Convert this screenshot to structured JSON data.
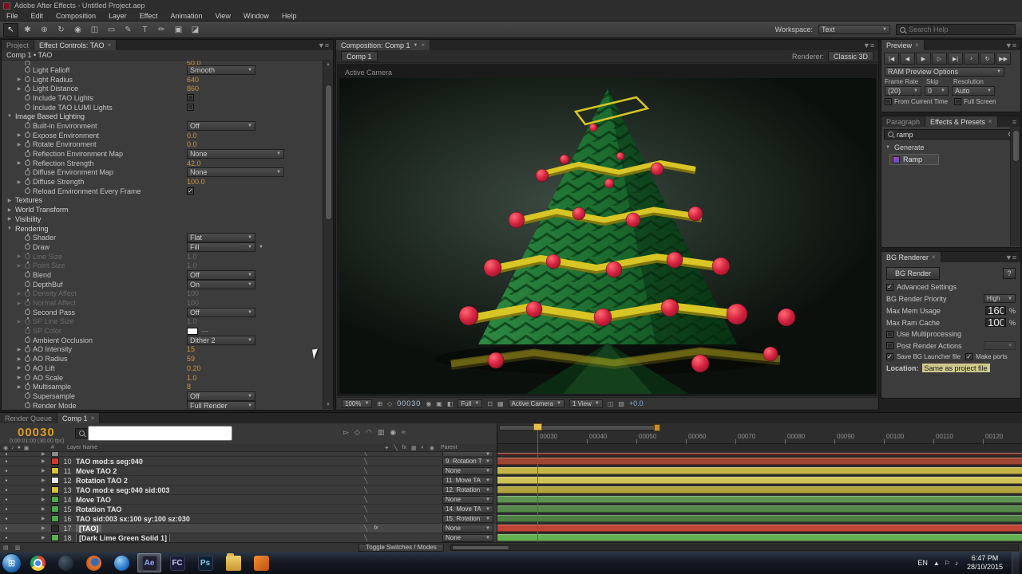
{
  "theme": {
    "value_orange": "#c9953a",
    "time_orange": "#d89a2a",
    "ribbon_yellow": "#d8c526",
    "ribbon_dark": "#8a7a10",
    "bauble_red": "#d42240",
    "tree_green": "#1c6b30"
  },
  "titlebar": {
    "title": "Adobe After Effects - Untitled Project.aep"
  },
  "menubar": {
    "items": [
      "File",
      "Edit",
      "Composition",
      "Layer",
      "Effect",
      "Animation",
      "View",
      "Window",
      "Help"
    ]
  },
  "toolbar": {
    "tools": [
      {
        "name": "selection-tool",
        "glyph": "↖",
        "active": true
      },
      {
        "name": "hand-tool",
        "glyph": "✱"
      },
      {
        "name": "zoom-tool",
        "glyph": "⊕"
      },
      {
        "name": "rotation-tool",
        "glyph": "↻"
      },
      {
        "name": "unified-camera-tool",
        "glyph": "◉"
      },
      {
        "name": "pan-behind-tool",
        "glyph": "◫"
      },
      {
        "name": "shape-tool",
        "glyph": "▭"
      },
      {
        "name": "pen-tool",
        "glyph": "✎"
      },
      {
        "name": "type-tool",
        "glyph": "T"
      },
      {
        "name": "brush-tool",
        "glyph": "✏"
      },
      {
        "name": "clone-stamp-tool",
        "glyph": "▣"
      },
      {
        "name": "eraser-tool",
        "glyph": "◪"
      }
    ],
    "workspace_label": "Workspace:",
    "workspace_value": "Text",
    "search_placeholder": "Search Help"
  },
  "effect_controls": {
    "project_tab": "Project",
    "tab": "Effect Controls: TAO",
    "breadcrumb": "Comp 1 • TAO",
    "rows": [
      {
        "label": "",
        "type": "value",
        "value": "50.0",
        "indent": 1,
        "partial": true
      },
      {
        "label": "Light Falloff",
        "type": "dropdown",
        "value": "Smooth",
        "indent": 1
      },
      {
        "label": "Light Radius",
        "type": "value",
        "value": "640",
        "indent": 1,
        "arrow": true
      },
      {
        "label": "Light Distance",
        "type": "value",
        "value": "860",
        "indent": 1,
        "arrow": true
      },
      {
        "label": "Include TAO Lights",
        "type": "check",
        "checked": false,
        "indent": 1
      },
      {
        "label": "Include TAO LUMI Lights",
        "type": "check",
        "checked": false,
        "indent": 1
      },
      {
        "label": "Image Based Lighting",
        "type": "group",
        "expanded": true,
        "indent": 0
      },
      {
        "label": "Built-in Environment",
        "type": "dropdown",
        "value": "Off",
        "indent": 1
      },
      {
        "label": "Expose Environment",
        "type": "value",
        "value": "0.0",
        "indent": 1,
        "arrow": true
      },
      {
        "label": "Rotate Environment",
        "type": "value",
        "value": "0.0",
        "indent": 1,
        "arrow": true
      },
      {
        "label": "Reflection Environment Map",
        "type": "dropdown",
        "value": "None",
        "indent": 1,
        "wide": true
      },
      {
        "label": "Reflection Strength",
        "type": "value",
        "value": "42.0",
        "indent": 1,
        "arrow": true
      },
      {
        "label": "Diffuse Environment Map",
        "type": "dropdown",
        "value": "None",
        "indent": 1,
        "wide": true
      },
      {
        "label": "Diffuse Strength",
        "type": "value",
        "value": "100.0",
        "indent": 1,
        "arrow": true
      },
      {
        "label": "Reload Environment Every Frame",
        "type": "check",
        "checked": true,
        "indent": 1
      },
      {
        "label": "Textures",
        "type": "group",
        "expanded": false,
        "indent": 0
      },
      {
        "label": "World Transform",
        "type": "group",
        "expanded": false,
        "indent": 0
      },
      {
        "label": "Visibility",
        "type": "group",
        "expanded": false,
        "indent": 0
      },
      {
        "label": "Rendering",
        "type": "group",
        "expanded": true,
        "indent": 0
      },
      {
        "label": "Shader",
        "type": "dropdown",
        "value": "Flat",
        "indent": 1
      },
      {
        "label": "Draw",
        "type": "dropdown",
        "value": "Fill",
        "indent": 1,
        "extra_arrow": true
      },
      {
        "label": "Line Size",
        "type": "value",
        "value": "1.0",
        "indent": 1,
        "arrow": true,
        "disabled": true
      },
      {
        "label": "Point Size",
        "type": "value",
        "value": "1.0",
        "indent": 1,
        "arrow": true,
        "disabled": true
      },
      {
        "label": "Blend",
        "type": "dropdown",
        "value": "Off",
        "indent": 1
      },
      {
        "label": "DepthBuf",
        "type": "dropdown",
        "value": "On",
        "indent": 1
      },
      {
        "label": "Density Affect",
        "type": "value",
        "value": "100",
        "indent": 1,
        "arrow": true,
        "disabled": true
      },
      {
        "label": "Normal Affect",
        "type": "value",
        "value": "100",
        "indent": 1,
        "arrow": true,
        "disabled": true
      },
      {
        "label": "Second Pass",
        "type": "dropdown",
        "value": "Off",
        "indent": 1
      },
      {
        "label": "SP Line Size",
        "type": "value",
        "value": "1.0",
        "indent": 1,
        "arrow": true,
        "disabled": true
      },
      {
        "label": "SP Color",
        "type": "color",
        "value": "#ffffff",
        "indent": 1,
        "disabled": true
      },
      {
        "label": "Ambient Occlusion",
        "type": "dropdown",
        "value": "Dither 2",
        "indent": 1
      },
      {
        "label": "AO Intensity",
        "type": "value",
        "value": "15",
        "indent": 1,
        "arrow": true
      },
      {
        "label": "AO Radius",
        "type": "value",
        "value": "59",
        "indent": 1,
        "arrow": true
      },
      {
        "label": "AO Lift",
        "type": "value",
        "value": "0.20",
        "indent": 1,
        "arrow": true
      },
      {
        "label": "AO Scale",
        "type": "value",
        "value": "1.0",
        "indent": 1,
        "arrow": true
      },
      {
        "label": "Multisample",
        "type": "value",
        "value": "8",
        "indent": 1,
        "arrow": true
      },
      {
        "label": "Supersample",
        "type": "dropdown",
        "value": "Off",
        "indent": 1
      },
      {
        "label": "Render Mode",
        "type": "dropdown",
        "value": "Full Render",
        "indent": 1
      }
    ]
  },
  "composition": {
    "tab": "Composition: Comp 1",
    "sub_tab": "Comp 1",
    "renderer_label": "Renderer:",
    "renderer_value": "Classic 3D",
    "view_label": "Active Camera",
    "statusbar_items": [
      {
        "kind": "dropdown",
        "name": "magnification-dropdown",
        "value": "100%"
      },
      {
        "kind": "icon",
        "name": "grid-options-icon",
        "glyph": "⊞"
      },
      {
        "kind": "icon",
        "name": "mask-visibility-icon",
        "glyph": "◇"
      },
      {
        "kind": "time",
        "name": "current-time-display",
        "value": "00030"
      },
      {
        "kind": "icon",
        "name": "snapshot-icon",
        "glyph": "◉"
      },
      {
        "kind": "icon",
        "name": "show-snapshot-icon",
        "glyph": "▣"
      },
      {
        "kind": "icon",
        "name": "channels-icon",
        "glyph": "◧"
      },
      {
        "kind": "dropdown",
        "name": "resolution-dropdown",
        "value": "Full"
      },
      {
        "kind": "icon",
        "name": "region-of-interest-icon",
        "glyph": "⊡"
      },
      {
        "kind": "icon",
        "name": "transparency-grid-icon",
        "glyph": "▦"
      },
      {
        "kind": "dropdown",
        "name": "view-camera-dropdown",
        "value": "Active Camera"
      },
      {
        "kind": "dropdown",
        "name": "view-layout-dropdown",
        "value": "1 View"
      },
      {
        "kind": "icon",
        "name": "pixel-aspect-icon",
        "glyph": "◫"
      },
      {
        "kind": "icon",
        "name": "fast-previews-icon",
        "glyph": "▧"
      },
      {
        "kind": "exposure",
        "name": "exposure-control",
        "value": "+0.0"
      }
    ]
  },
  "preview": {
    "tab": "Preview",
    "buttons": [
      {
        "name": "first-frame-button",
        "glyph": "|◀"
      },
      {
        "name": "previous-frame-button",
        "glyph": "◀"
      },
      {
        "name": "play-button",
        "glyph": "▶"
      },
      {
        "name": "next-frame-button",
        "glyph": "▷"
      },
      {
        "name": "last-frame-button",
        "glyph": "▶|"
      },
      {
        "name": "audio-toggle-button",
        "glyph": "♪"
      },
      {
        "name": "loop-toggle-button",
        "glyph": "↻"
      },
      {
        "name": "ram-preview-button",
        "glyph": "▶▶"
      }
    ],
    "ram_options": "RAM Preview Options",
    "frame_rate_label": "Frame Rate",
    "skip_label": "Skip",
    "resolution_label": "Resolution",
    "frame_rate_value": "(20)",
    "skip_value": "0",
    "resolution_value": "Auto",
    "from_current_time": "From Current Time",
    "full_screen": "Full Screen"
  },
  "effects_presets": {
    "tab_paragraph": "Paragraph",
    "tab": "Effects & Presets",
    "search_value": "ramp",
    "group": "Generate",
    "item": "Ramp"
  },
  "bg_renderer": {
    "tab": "BG Renderer",
    "render_button": "BG Render",
    "help_button": "?",
    "advanced_settings": "Advanced Settings",
    "priority_label": "BG Render Priority",
    "priority_value": "High",
    "max_mem_label": "Max Mem Usage",
    "max_mem_value": "160",
    "max_ram_label": "Max Ram Cache",
    "max_ram_value": "100",
    "percent": "%",
    "use_multiprocessing": "Use Multiprocessing",
    "post_render_actions": "Post Render Actions",
    "save_bg_launcher": "Save BG Launcher file",
    "make_ports": "Make ports",
    "location_label": "Location:",
    "location_value": "Same as project file"
  },
  "timeline": {
    "tab_render_queue": "Render Queue",
    "tab_comp": "Comp 1",
    "current_time": "00030",
    "time_info": "0:00:01:00 (30.00 fps)",
    "toolbar_icons": [
      {
        "name": "composition-mini-flowchart-icon",
        "glyph": "▻"
      },
      {
        "name": "draft-3d-icon",
        "glyph": "◇"
      },
      {
        "name": "hide-shy-layers-icon",
        "glyph": "◠"
      },
      {
        "name": "frame-blending-icon",
        "glyph": "▥"
      },
      {
        "name": "motion-blur-icon",
        "glyph": "◉"
      },
      {
        "name": "graph-editor-icon",
        "glyph": "≈"
      }
    ],
    "colhead": {
      "hash": "#",
      "layer_name": "Layer Name",
      "parent": "Parent"
    },
    "av_icons": [
      {
        "name": "video-column-icon",
        "glyph": "◉"
      },
      {
        "name": "audio-column-icon",
        "glyph": "♪"
      },
      {
        "name": "solo-column-icon",
        "glyph": "●"
      },
      {
        "name": "lock-column-icon",
        "glyph": "▣"
      }
    ],
    "switch_icons": [
      {
        "name": "shy-column-icon",
        "glyph": "✦"
      },
      {
        "name": "quality-column-icon",
        "glyph": "╲"
      },
      {
        "name": "effects-column-icon",
        "glyph": "fx"
      },
      {
        "name": "frame-blend-column-icon",
        "glyph": "▦"
      },
      {
        "name": "motion-blur-column-icon",
        "glyph": "◐"
      },
      {
        "name": "three-d-column-icon",
        "glyph": "◉"
      }
    ],
    "ruler_labels": [
      "00030",
      "00040",
      "00050",
      "00060",
      "00070",
      "00080",
      "00090",
      "00100",
      "00110",
      "00120"
    ],
    "layers": [
      {
        "index": "",
        "name": "",
        "parent": "",
        "color": "#8a8a8a",
        "bar": "#7a3028",
        "partial": true
      },
      {
        "index": "10",
        "name": "TAO mod:s seg:040",
        "parent": "9. Rotation T",
        "color": "#cc3a2e",
        "bar": "#a04432"
      },
      {
        "index": "11",
        "name": "Move TAO 2",
        "parent": "None",
        "color": "#d8c23a",
        "bar": "#c4b448"
      },
      {
        "index": "12",
        "name": "Rotation TAO 2",
        "parent": "11. Move TA",
        "color": "#e8e8e8",
        "bar": "#cec258"
      },
      {
        "index": "13",
        "name": "TAO mod:e seg:040 sid:003",
        "parent": "12. Rotation",
        "color": "#d8c23a",
        "bar": "#b2a53e"
      },
      {
        "index": "14",
        "name": "Move TAO",
        "parent": "None",
        "color": "#4ca84a",
        "bar": "#5e9452"
      },
      {
        "index": "15",
        "name": "Rotation TAO",
        "parent": "14. Move TA",
        "color": "#4ca84a",
        "bar": "#55894a"
      },
      {
        "index": "16",
        "name": "TAO sid:003  sx:100 sy:100 sz:030",
        "parent": "15. Rotation",
        "color": "#4ca84a",
        "bar": "#4d7f44"
      },
      {
        "index": "17",
        "name": "[TAO]",
        "parent": "None",
        "color": "#2a2a2a",
        "bar": "#c04434",
        "boxed": true,
        "selected": true,
        "fx": true
      },
      {
        "index": "18",
        "name": "[Dark Lime Green Solid 1]",
        "parent": "None",
        "color": "#5ab04e",
        "bar": "#67b052",
        "boxed": true
      }
    ],
    "toggle_button": "Toggle Switches / Modes"
  },
  "taskbar": {
    "icons": [
      {
        "name": "start-button",
        "type": "orb"
      },
      {
        "name": "chrome-icon",
        "type": "chrome"
      },
      {
        "name": "dark-app-icon",
        "type": "dark-circle"
      },
      {
        "name": "firefox-icon",
        "type": "firefox"
      },
      {
        "name": "media-app-icon",
        "type": "blue-circle"
      },
      {
        "name": "after-effects-icon",
        "type": "square",
        "label": "Ae",
        "fg": "#9aa8f0",
        "bg": "#1e1e2e",
        "active": true
      },
      {
        "name": "flash-catalyst-icon",
        "type": "square",
        "label": "FC",
        "fg": "#c8c8f0",
        "bg": "#1a1a3a"
      },
      {
        "name": "photoshop-icon",
        "type": "square",
        "label": "Ps",
        "fg": "#8ec6e8",
        "bg": "#0a2232"
      },
      {
        "name": "folder-icon",
        "type": "folder"
      },
      {
        "name": "tools-app-icon",
        "type": "orange"
      }
    ],
    "tray_icons": [
      {
        "name": "show-hidden-icons",
        "glyph": "▲"
      },
      {
        "name": "action-center-icon",
        "glyph": "⚐"
      },
      {
        "name": "volume-icon",
        "glyph": "♪"
      }
    ],
    "language": "EN",
    "time": "6:47 PM",
    "date": "28/10/2015"
  }
}
